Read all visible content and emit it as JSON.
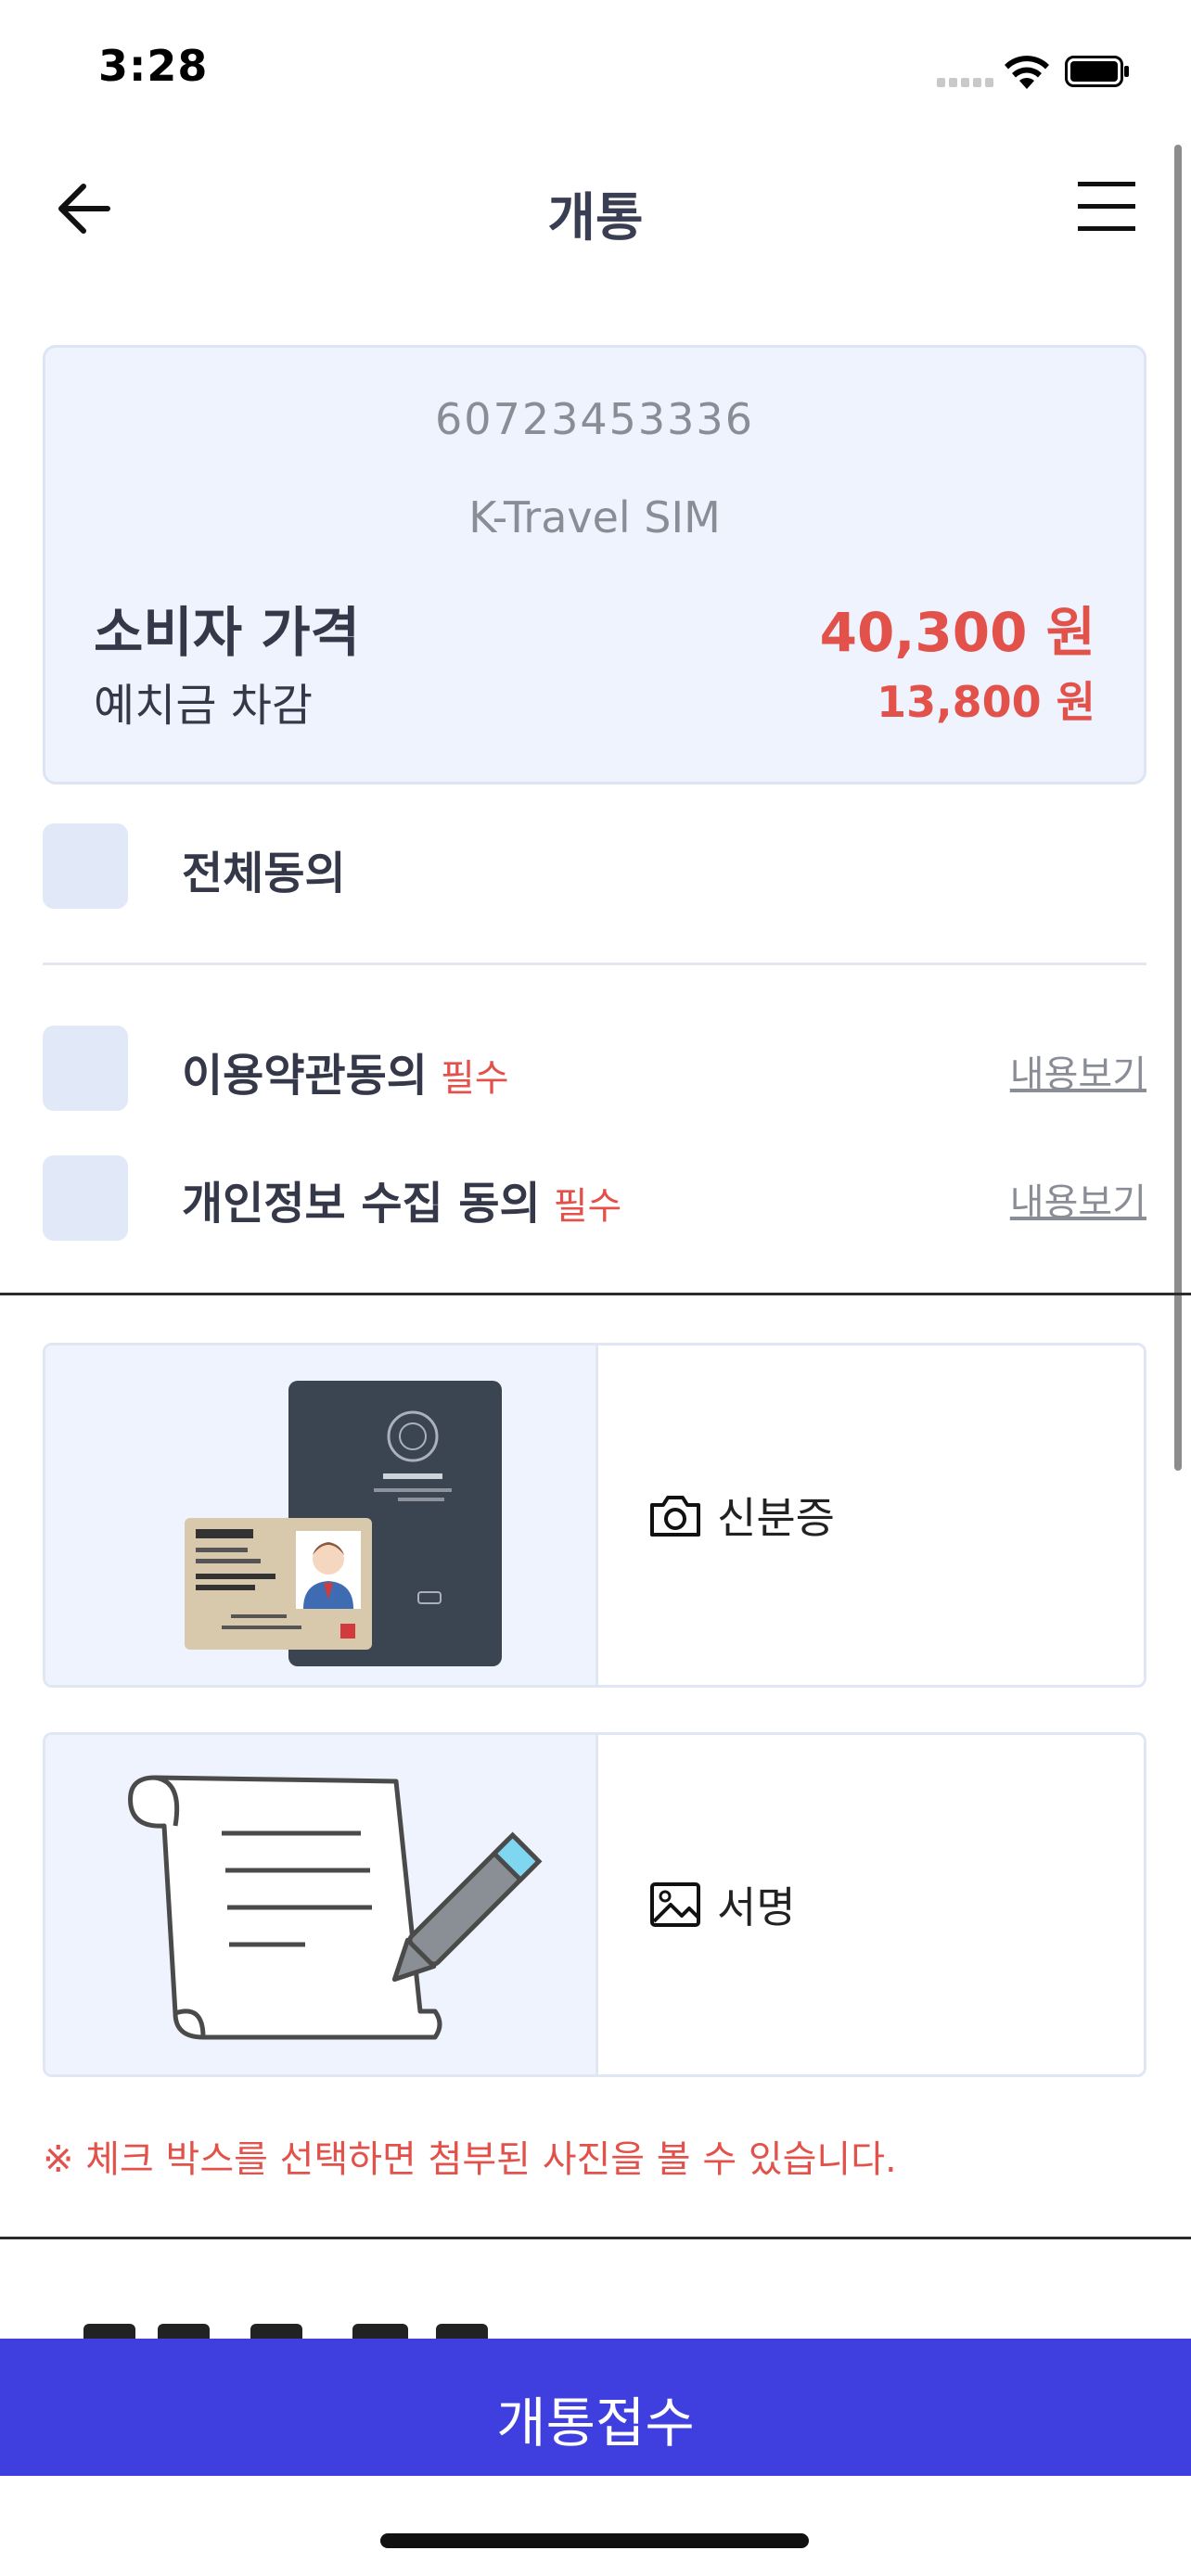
{
  "status_bar": {
    "time": "3:28"
  },
  "header": {
    "title": "개통"
  },
  "product": {
    "number": "60723453336",
    "name": "K-Travel SIM",
    "price_label": "소비자 가격",
    "price_value": "40,300 원",
    "deposit_label": "예치금 차감",
    "deposit_value": "13,800 원"
  },
  "agreements": {
    "all_label": "전체동의",
    "items": [
      {
        "label": "이용약관동의",
        "required": "필수",
        "link": "내용보기"
      },
      {
        "label": "개인정보 수집 동의",
        "required": "필수",
        "link": "내용보기"
      }
    ]
  },
  "uploads": [
    {
      "label": "신분증",
      "icon": "camera-icon"
    },
    {
      "label": "서명",
      "icon": "image-icon"
    }
  ],
  "notice": "※ 체크 박스를 선택하면 첨부된 사진을 볼 수 있습니다.",
  "submit": {
    "label": "개통접수"
  },
  "colors": {
    "accent": "#3f3fe0",
    "price_red": "#e2524b",
    "card_bg": "#eef3fd",
    "checkbox_bg": "#e1e8f7"
  }
}
